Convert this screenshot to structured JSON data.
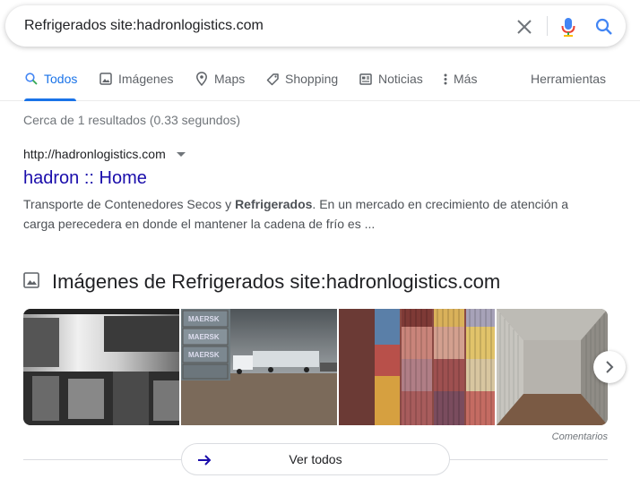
{
  "search": {
    "query": "Refrigerados site:hadronlogistics.com",
    "icons": {
      "clear": "close-icon",
      "mic": "microphone-icon",
      "search": "search-icon"
    }
  },
  "tabs": [
    {
      "label": "Todos",
      "icon": "search-icon",
      "active": true
    },
    {
      "label": "Imágenes",
      "icon": "image-icon"
    },
    {
      "label": "Maps",
      "icon": "map-pin-icon"
    },
    {
      "label": "Shopping",
      "icon": "tag-icon"
    },
    {
      "label": "Noticias",
      "icon": "news-icon"
    },
    {
      "label": "Más",
      "icon": "more-vert-icon"
    }
  ],
  "tools_label": "Herramientas",
  "stats": "Cerca de 1 resultados (0.33 segundos)",
  "result": {
    "url": "http://hadronlogistics.com",
    "title": "hadron :: Home",
    "snippet_before": "Transporte de Contenedores Secos y ",
    "snippet_bold": "Refrigerados",
    "snippet_after": ". En un mercado en crecimiento de atención a carga perecedera en donde el mantener la cadena de frío es ..."
  },
  "images": {
    "heading": "Imágenes de Refrigerados site:hadronlogistics.com",
    "feedback": "Comentarios",
    "view_all": "Ver todos",
    "thumbnail_text": "MAERSK"
  },
  "colors": {
    "accent": "#1a73e8",
    "link": "#1a0dab",
    "muted": "#70757a"
  }
}
